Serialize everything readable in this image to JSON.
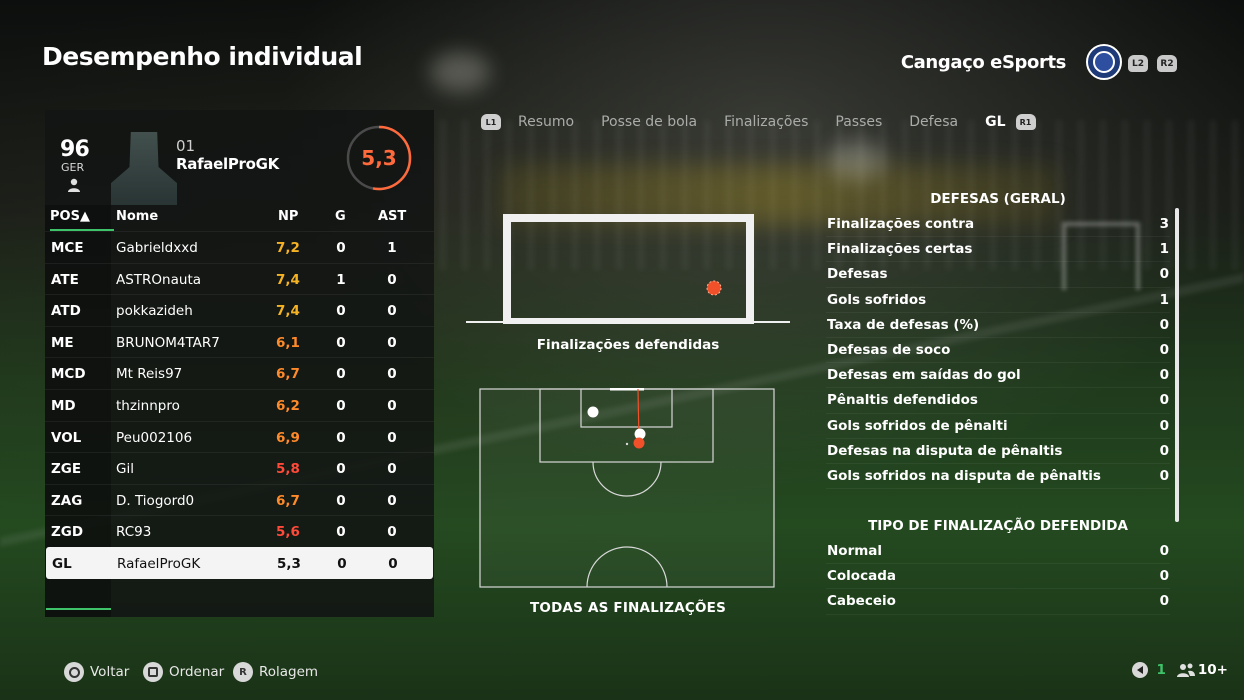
{
  "header": {
    "title": "Desempenho individual",
    "team_name": "Cangaço eSports",
    "chips": {
      "l2": "L2",
      "r2": "R2"
    }
  },
  "tabs": {
    "left_chip": "L1",
    "items": [
      "Resumo",
      "Posse de bola",
      "Finalizações",
      "Passes",
      "Defesa",
      "GL"
    ],
    "active": "GL",
    "right_chip": "R1"
  },
  "player": {
    "overall": "96",
    "position": "GER",
    "number": "01",
    "name": "RafaelProGK",
    "rating": "5,3",
    "rating_color": "#ff6a3d",
    "rating_fraction": 0.53
  },
  "table": {
    "headers": {
      "pos": "POS▲",
      "name": "Nome",
      "np": "NP",
      "g": "G",
      "ast": "AST"
    },
    "rows": [
      {
        "pos": "MCE",
        "name": "Gabrieldxxd",
        "np": "7,2",
        "np_color": "#f5b324",
        "g": "0",
        "ast": "1"
      },
      {
        "pos": "ATE",
        "name": "ASTROnauta",
        "np": "7,4",
        "np_color": "#f5b324",
        "g": "1",
        "ast": "0"
      },
      {
        "pos": "ATD",
        "name": "pokkazideh",
        "np": "7,4",
        "np_color": "#f5b324",
        "g": "0",
        "ast": "0"
      },
      {
        "pos": "ME",
        "name": "BRUNOM4TAR7",
        "np": "6,1",
        "np_color": "#ff8a2a",
        "g": "0",
        "ast": "0"
      },
      {
        "pos": "MCD",
        "name": "Mt Reis97",
        "np": "6,7",
        "np_color": "#ff8a2a",
        "g": "0",
        "ast": "0"
      },
      {
        "pos": "MD",
        "name": "thzinnpro",
        "np": "6,2",
        "np_color": "#ff8a2a",
        "g": "0",
        "ast": "0"
      },
      {
        "pos": "VOL",
        "name": "Peu002106",
        "np": "6,9",
        "np_color": "#ff8a2a",
        "g": "0",
        "ast": "0"
      },
      {
        "pos": "ZGE",
        "name": "Gil",
        "np": "5,8",
        "np_color": "#ff4a3a",
        "g": "0",
        "ast": "0"
      },
      {
        "pos": "ZAG",
        "name": "D. Tiogord0",
        "np": "6,7",
        "np_color": "#ff8a2a",
        "g": "0",
        "ast": "0"
      },
      {
        "pos": "ZGD",
        "name": "RC93",
        "np": "5,6",
        "np_color": "#ff4a3a",
        "g": "0",
        "ast": "0"
      },
      {
        "pos": "GL",
        "name": "RafaelProGK",
        "np": "5,3",
        "np_color": "#111111",
        "g": "0",
        "ast": "0",
        "selected": true
      }
    ]
  },
  "graphics": {
    "goal_caption": "Finalizações defendidas",
    "field_caption": "TODAS AS FINALIZAÇÕES",
    "accent_shot": "#f0502a"
  },
  "stats": {
    "section1_title": "DEFESAS (GERAL)",
    "section1": [
      {
        "label": "Finalizações contra",
        "value": "3"
      },
      {
        "label": "Finalizações certas",
        "value": "1"
      },
      {
        "label": "Defesas",
        "value": "0"
      },
      {
        "label": "Gols sofridos",
        "value": "1"
      },
      {
        "label": "Taxa de defesas (%)",
        "value": "0"
      },
      {
        "label": "Defesas de soco",
        "value": "0"
      },
      {
        "label": "Defesas em saídas do gol",
        "value": "0"
      },
      {
        "label": "Pênaltis defendidos",
        "value": "0"
      },
      {
        "label": "Gols sofridos de pênalti",
        "value": "0"
      },
      {
        "label": "Defesas na disputa de pênaltis",
        "value": "0"
      },
      {
        "label": "Gols sofridos na disputa de pênaltis",
        "value": "0"
      }
    ],
    "section2_title": "TIPO DE FINALIZAÇÃO DEFENDIDA",
    "section2": [
      {
        "label": "Normal",
        "value": "0"
      },
      {
        "label": "Colocada",
        "value": "0"
      },
      {
        "label": "Cabeceio",
        "value": "0"
      }
    ]
  },
  "footer": {
    "back": "Voltar",
    "sort": "Ordenar",
    "scroll": "Rolagem",
    "scroll_chip": "R",
    "online": "1",
    "players": "10+"
  }
}
